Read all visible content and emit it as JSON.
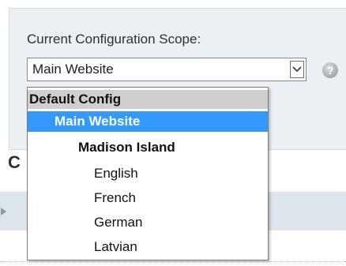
{
  "scope": {
    "label": "Current Configuration Scope:",
    "selected": "Main Website"
  },
  "dropdown": {
    "default_option": "Default Config",
    "website": "Main Website",
    "store": "Madison Island",
    "store_views": [
      "English",
      "French",
      "German",
      "Latvian"
    ]
  },
  "background": {
    "heading_partial": "C"
  },
  "colors": {
    "highlight": "#3399ff",
    "panel_bg": "#eaf0f3",
    "default_row_bg": "#cfcfcf"
  },
  "icons": {
    "select_arrow": "chevron-down-icon",
    "help": "help-icon",
    "section_toggle": "collapse-arrow-icon"
  }
}
